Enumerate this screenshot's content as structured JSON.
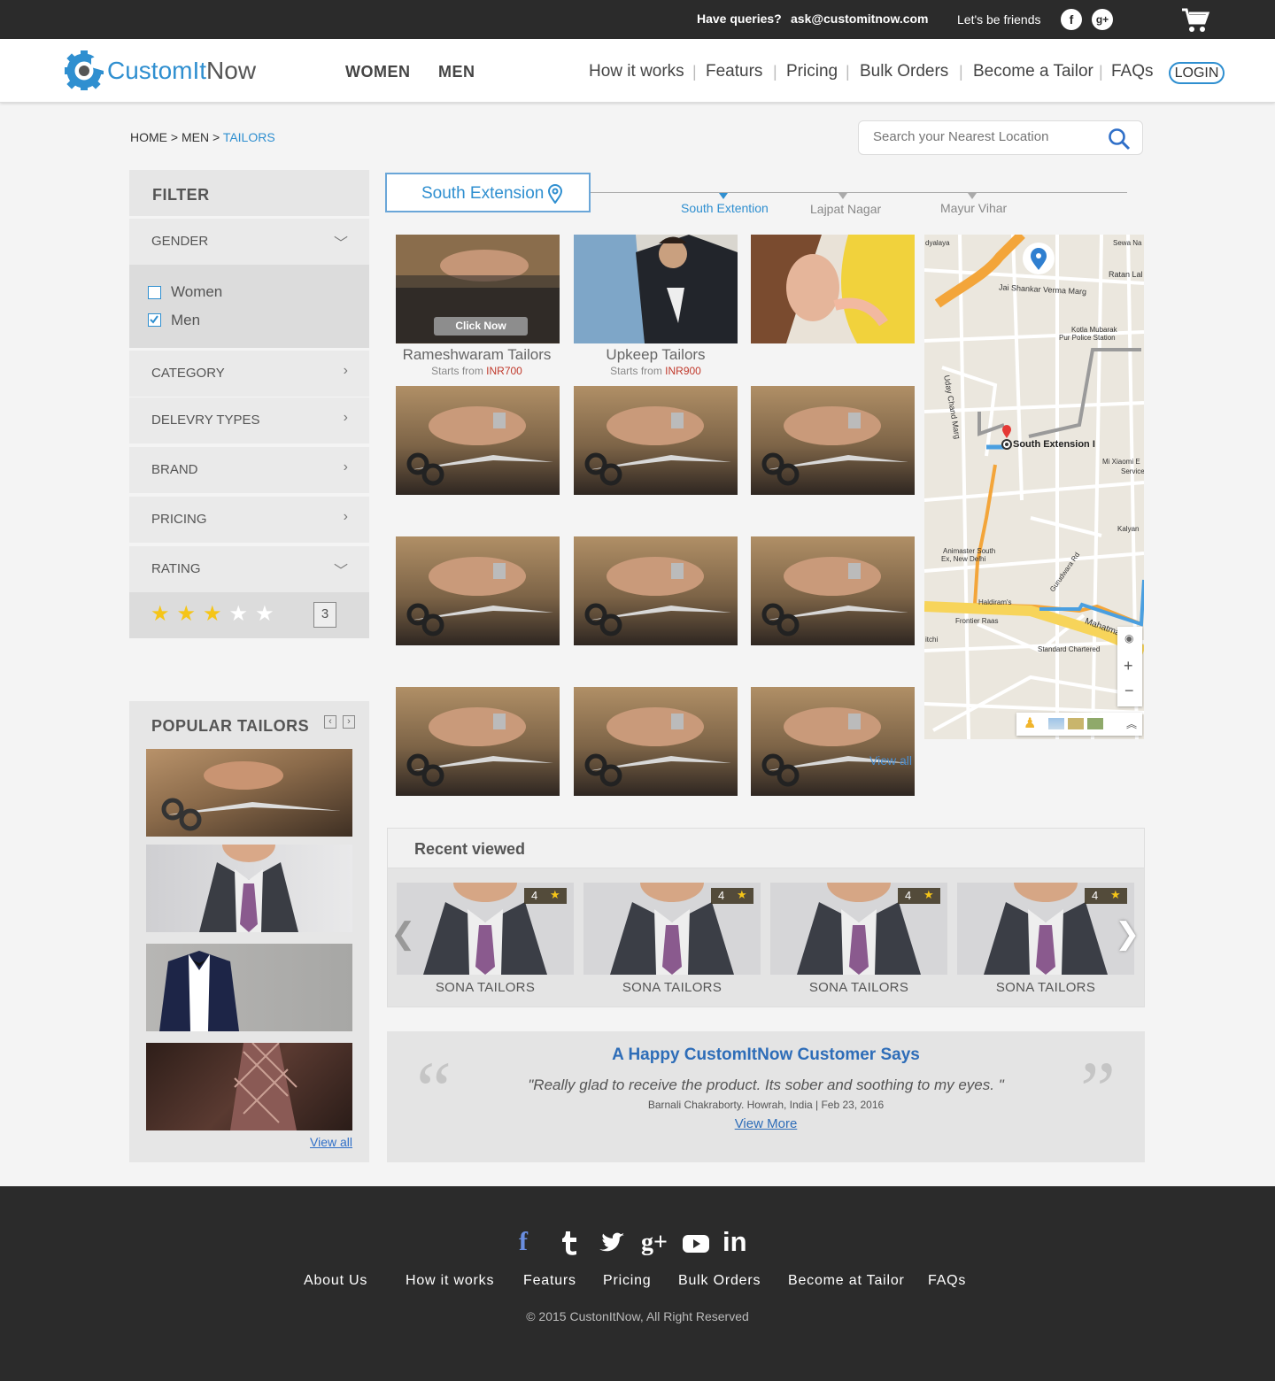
{
  "topbar": {
    "queries_label": "Have queries?",
    "email": "ask@customitnow.com",
    "friends_label": "Let's be friends",
    "facebook_glyph": "f",
    "googleplus_glyph": "g+"
  },
  "header": {
    "logo_part1": "CustomIt",
    "logo_part2": "Now",
    "gender_nav": [
      "WOMEN",
      "MEN"
    ],
    "nav": [
      "How it works",
      "Featurs",
      "Pricing",
      "Bulk Orders",
      "Become a Tailor",
      "FAQs"
    ],
    "login": "LOGIN"
  },
  "breadcrumb": {
    "home": "HOME",
    "sep": ">",
    "men": "MEN",
    "current": "TAILORS"
  },
  "search": {
    "placeholder": "Search your Nearest Location"
  },
  "filter": {
    "title": "FILTER",
    "gender_label": "GENDER",
    "gender_options": [
      {
        "label": "Women",
        "checked": false
      },
      {
        "label": "Men",
        "checked": true
      }
    ],
    "category_label": "CATEGORY",
    "delivery_label": "DELEVRY TYPES",
    "brand_label": "BRAND",
    "pricing_label": "PRICING",
    "rating_label": "RATING",
    "rating_value": 3,
    "rating_max": 5,
    "rating_display": "3"
  },
  "location": {
    "selected": "South Extension",
    "tabs": [
      "South Extention",
      "Lajpat Nagar",
      "Mayur Vihar"
    ],
    "active_tab": 0
  },
  "tiles": [
    {
      "name": "Rameshwaram Tailors",
      "starts_from": "Starts from",
      "price": "INR700",
      "overlay": "Click Now"
    },
    {
      "name": "Upkeep Tailors",
      "starts_from": "Starts from",
      "price": "INR900"
    }
  ],
  "tiles_view_all": "View all",
  "map": {
    "labels": [
      "Sewa Na",
      "dyalaya",
      "Ratan Lal",
      "Jai Shankar Verma Marg",
      "Kotla Mubarak",
      "Pur Police Station",
      "Uday Chand Marg",
      "South Extension I",
      "Mi Xiaomi E",
      "Service",
      "Kalyan",
      "Animaster South",
      "Ex, New Delhi",
      "Gurudwara Rd",
      "Haldiram's",
      "Frontier Raas",
      "Mahatma G",
      "Standard Chartered",
      "itchi"
    ],
    "zoom_in": "+",
    "zoom_out": "−"
  },
  "recent": {
    "title": "Recent viewed",
    "cards": [
      {
        "name": "SONA TAILORS",
        "rating": "4"
      },
      {
        "name": "SONA TAILORS",
        "rating": "4"
      },
      {
        "name": "SONA TAILORS",
        "rating": "4"
      },
      {
        "name": "SONA TAILORS",
        "rating": "4"
      }
    ]
  },
  "testimonial": {
    "title": "A Happy CustomItNow Customer Says",
    "quote": "\"Really glad to receive the product. Its sober and soothing to my eyes. \"",
    "author": "Barnali Chakraborty. Howrah, India | Feb 23, 2016",
    "view_more": "View More"
  },
  "popular": {
    "title": "POPULAR TAILORS",
    "view_all": "View all"
  },
  "footer": {
    "links": [
      "About Us",
      "How it works",
      "Featurs",
      "Pricing",
      "Bulk Orders",
      "Become at Tailor",
      "FAQs"
    ],
    "copyright": "© 2015 CustonItNow, All Right Reserved"
  },
  "colors": {
    "accent": "#2f8fd0",
    "dark": "#2b2b2b",
    "price": "#c0392b",
    "star": "#f5c518"
  }
}
